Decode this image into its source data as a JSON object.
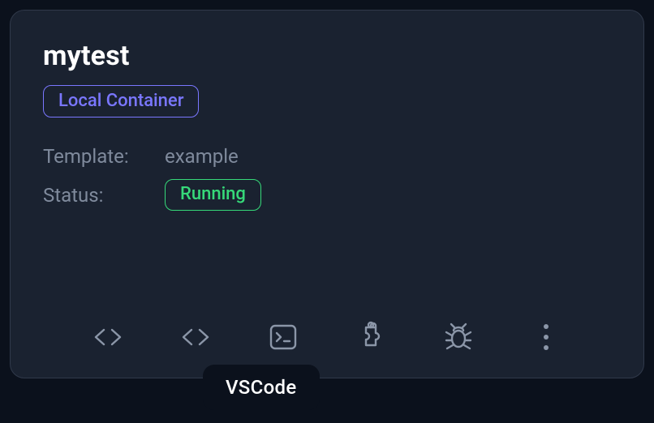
{
  "card": {
    "title": "mytest",
    "badge": "Local Container",
    "template_label": "Template:",
    "template_value": "example",
    "status_label": "Status:",
    "status_value": "Running"
  },
  "actions": {
    "code1_name": "code-icon",
    "code2_name": "vscode-icon",
    "terminal_name": "terminal-icon",
    "extension_name": "extension-icon",
    "debug_name": "debug-icon",
    "more_name": "more-icon"
  },
  "tooltip": {
    "label": "VSCode"
  },
  "colors": {
    "accent_violet": "#7a77ff",
    "status_green": "#36d979",
    "icon_grey": "#8b96a8",
    "card_bg": "#1a2230",
    "page_bg": "#0b111c"
  }
}
